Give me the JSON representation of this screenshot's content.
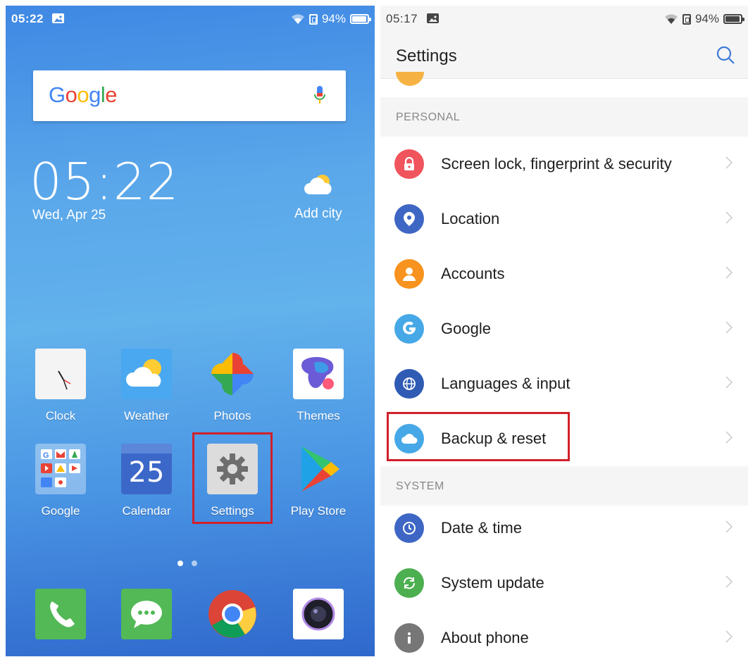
{
  "home": {
    "status": {
      "time": "05:22",
      "battery": "94%",
      "battery_level": 0.94
    },
    "search_logo": [
      "G",
      "o",
      "o",
      "g",
      "l",
      "e"
    ],
    "search_logo_colors": [
      "#4285F4",
      "#EA4335",
      "#FBBC05",
      "#4285F4",
      "#34A853",
      "#EA4335"
    ],
    "clock": "05:22",
    "date": "Wed, Apr 25",
    "add_city": "Add city",
    "apps_row1": [
      {
        "label": "Clock",
        "icon": "clock-icon"
      },
      {
        "label": "Weather",
        "icon": "weather-icon"
      },
      {
        "label": "Photos",
        "icon": "photos-icon"
      },
      {
        "label": "Themes",
        "icon": "themes-icon"
      }
    ],
    "apps_row2": [
      {
        "label": "Google",
        "icon": "google-folder-icon"
      },
      {
        "label": "Calendar",
        "icon": "calendar-icon",
        "day": "25"
      },
      {
        "label": "Settings",
        "icon": "settings-gear-icon"
      },
      {
        "label": "Play Store",
        "icon": "play-store-icon"
      }
    ],
    "page_count": 2,
    "active_page": 1
  },
  "settings": {
    "status": {
      "time": "05:17",
      "battery": "94%",
      "battery_level": 0.94
    },
    "title": "Settings",
    "sections": {
      "personal": "PERSONAL",
      "system": "SYSTEM"
    },
    "personal_items": [
      {
        "label": "Screen lock, fingerprint & security",
        "icon": "lock-icon",
        "color": "#F0545C"
      },
      {
        "label": "Location",
        "icon": "location-pin-icon",
        "color": "#3E66C4"
      },
      {
        "label": "Accounts",
        "icon": "person-icon",
        "color": "#F7931E"
      },
      {
        "label": "Google",
        "icon": "google-g-icon",
        "color": "#46A8E6"
      },
      {
        "label": "Languages & input",
        "icon": "globe-icon",
        "color": "#2F5BB4"
      },
      {
        "label": "Backup & reset",
        "icon": "cloud-icon",
        "color": "#46A8E6"
      }
    ],
    "system_items": [
      {
        "label": "Date & time",
        "icon": "clock-icon",
        "color": "#3E66C4"
      },
      {
        "label": "System update",
        "icon": "refresh-icon",
        "color": "#4CAF50"
      },
      {
        "label": "About phone",
        "icon": "info-icon",
        "color": "#777777"
      }
    ]
  },
  "colors": {
    "highlight": "#d0202a",
    "section_bg": "#f5f5f5"
  }
}
